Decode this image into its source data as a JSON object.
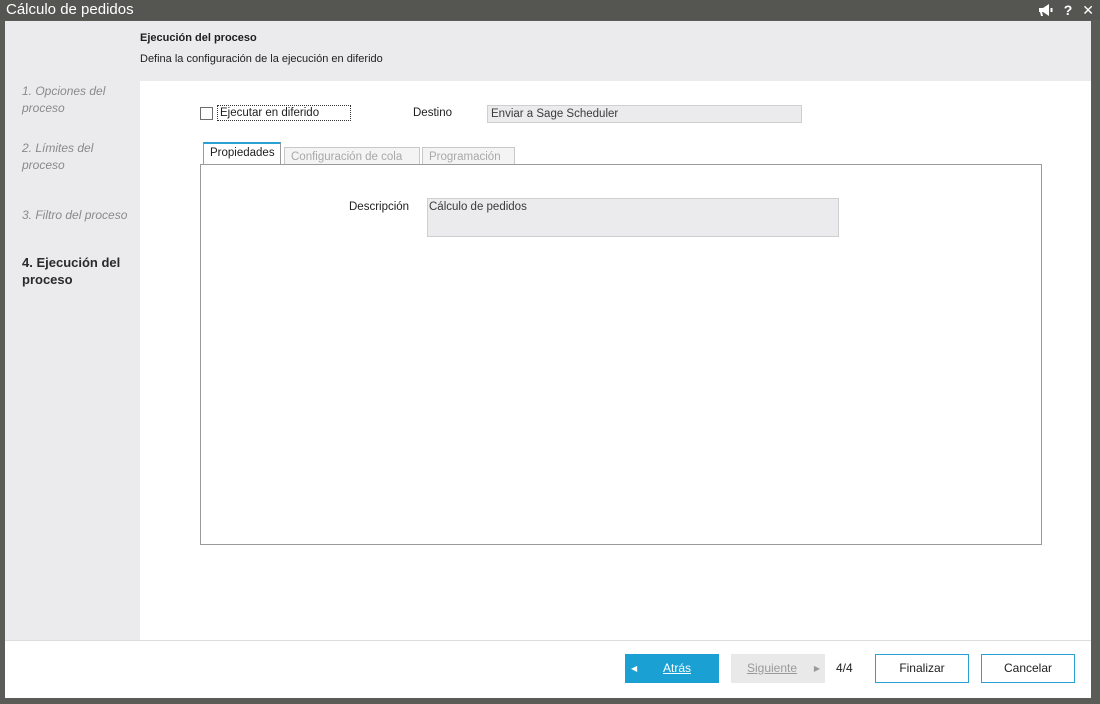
{
  "window": {
    "title": "Cálculo de pedidos",
    "icons": [
      "announcement-icon",
      "help-icon",
      "close-icon"
    ],
    "help_glyph": "?",
    "close_glyph": "✕"
  },
  "header": {
    "title": "Ejecución del proceso",
    "subtitle": "Defina la configuración de la ejecución en diferido"
  },
  "steps": [
    {
      "label": "1. Opciones del proceso",
      "active": false
    },
    {
      "label": "2. Límites del proceso",
      "active": false
    },
    {
      "label": "3. Filtro del proceso",
      "active": false
    },
    {
      "label": "4. Ejecución del proceso",
      "active": true
    }
  ],
  "form": {
    "run_deferred_label": "Ejecutar en diferido",
    "run_deferred_checked": false,
    "destination_label": "Destino",
    "destination_value": "Enviar a Sage Scheduler"
  },
  "tabs": [
    {
      "label": "Propiedades",
      "active": true,
      "enabled": true
    },
    {
      "label": "Configuración de cola",
      "active": false,
      "enabled": false
    },
    {
      "label": "Programación",
      "active": false,
      "enabled": false
    }
  ],
  "properties": {
    "description_label": "Descripción",
    "description_value": "Cálculo de pedidos"
  },
  "footer": {
    "back_label": "Atrás",
    "next_label": "Siguiente",
    "page_indicator": "4/4",
    "finish_label": "Finalizar",
    "cancel_label": "Cancelar"
  },
  "colors": {
    "accent": "#1aa0d3",
    "titlebar": "#555551",
    "sidebar": "#ebebed"
  }
}
